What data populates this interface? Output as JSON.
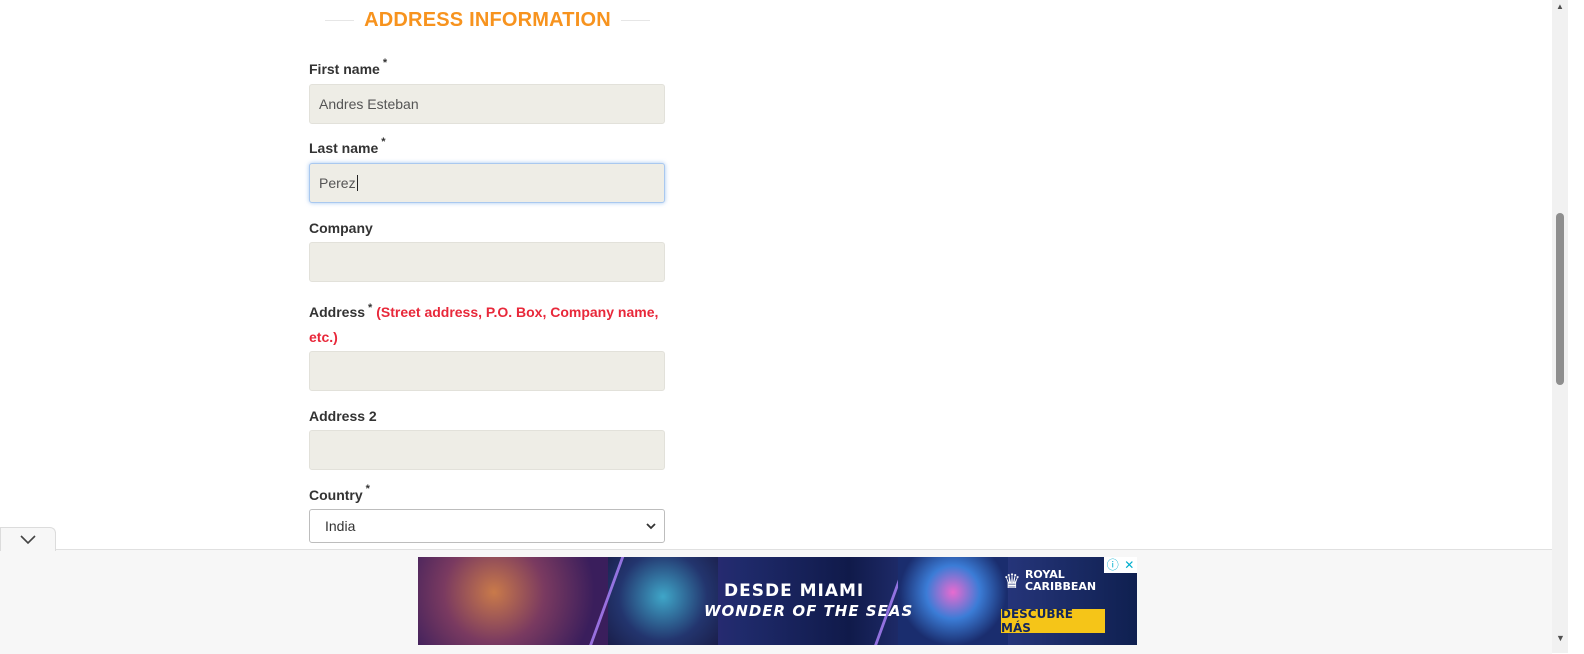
{
  "section_title": "ADDRESS INFORMATION",
  "required_mark": "*",
  "fields": {
    "first_name": {
      "label": "First name",
      "value": "Andres Esteban"
    },
    "last_name": {
      "label": "Last name",
      "value": "Perez"
    },
    "company": {
      "label": "Company",
      "value": ""
    },
    "address": {
      "label": "Address",
      "hint": "(Street address, P.O. Box, Company name, etc.)",
      "value": ""
    },
    "address2": {
      "label": "Address 2",
      "value": ""
    },
    "country": {
      "label": "Country",
      "value": "India"
    }
  },
  "ad": {
    "headline": "DESDE MIAMI",
    "subline": "WONDER OF THE SEAS",
    "brand_line1": "ROYAL",
    "brand_line2": "CARIBBEAN",
    "cta": "DESCUBRE MÁS",
    "info_icon": "ⓘ",
    "close_icon": "✕"
  },
  "colors": {
    "heading": "#f7931e",
    "hint": "#e8283a",
    "field_bg": "#eeede6",
    "ad_cta": "#f5c518"
  }
}
